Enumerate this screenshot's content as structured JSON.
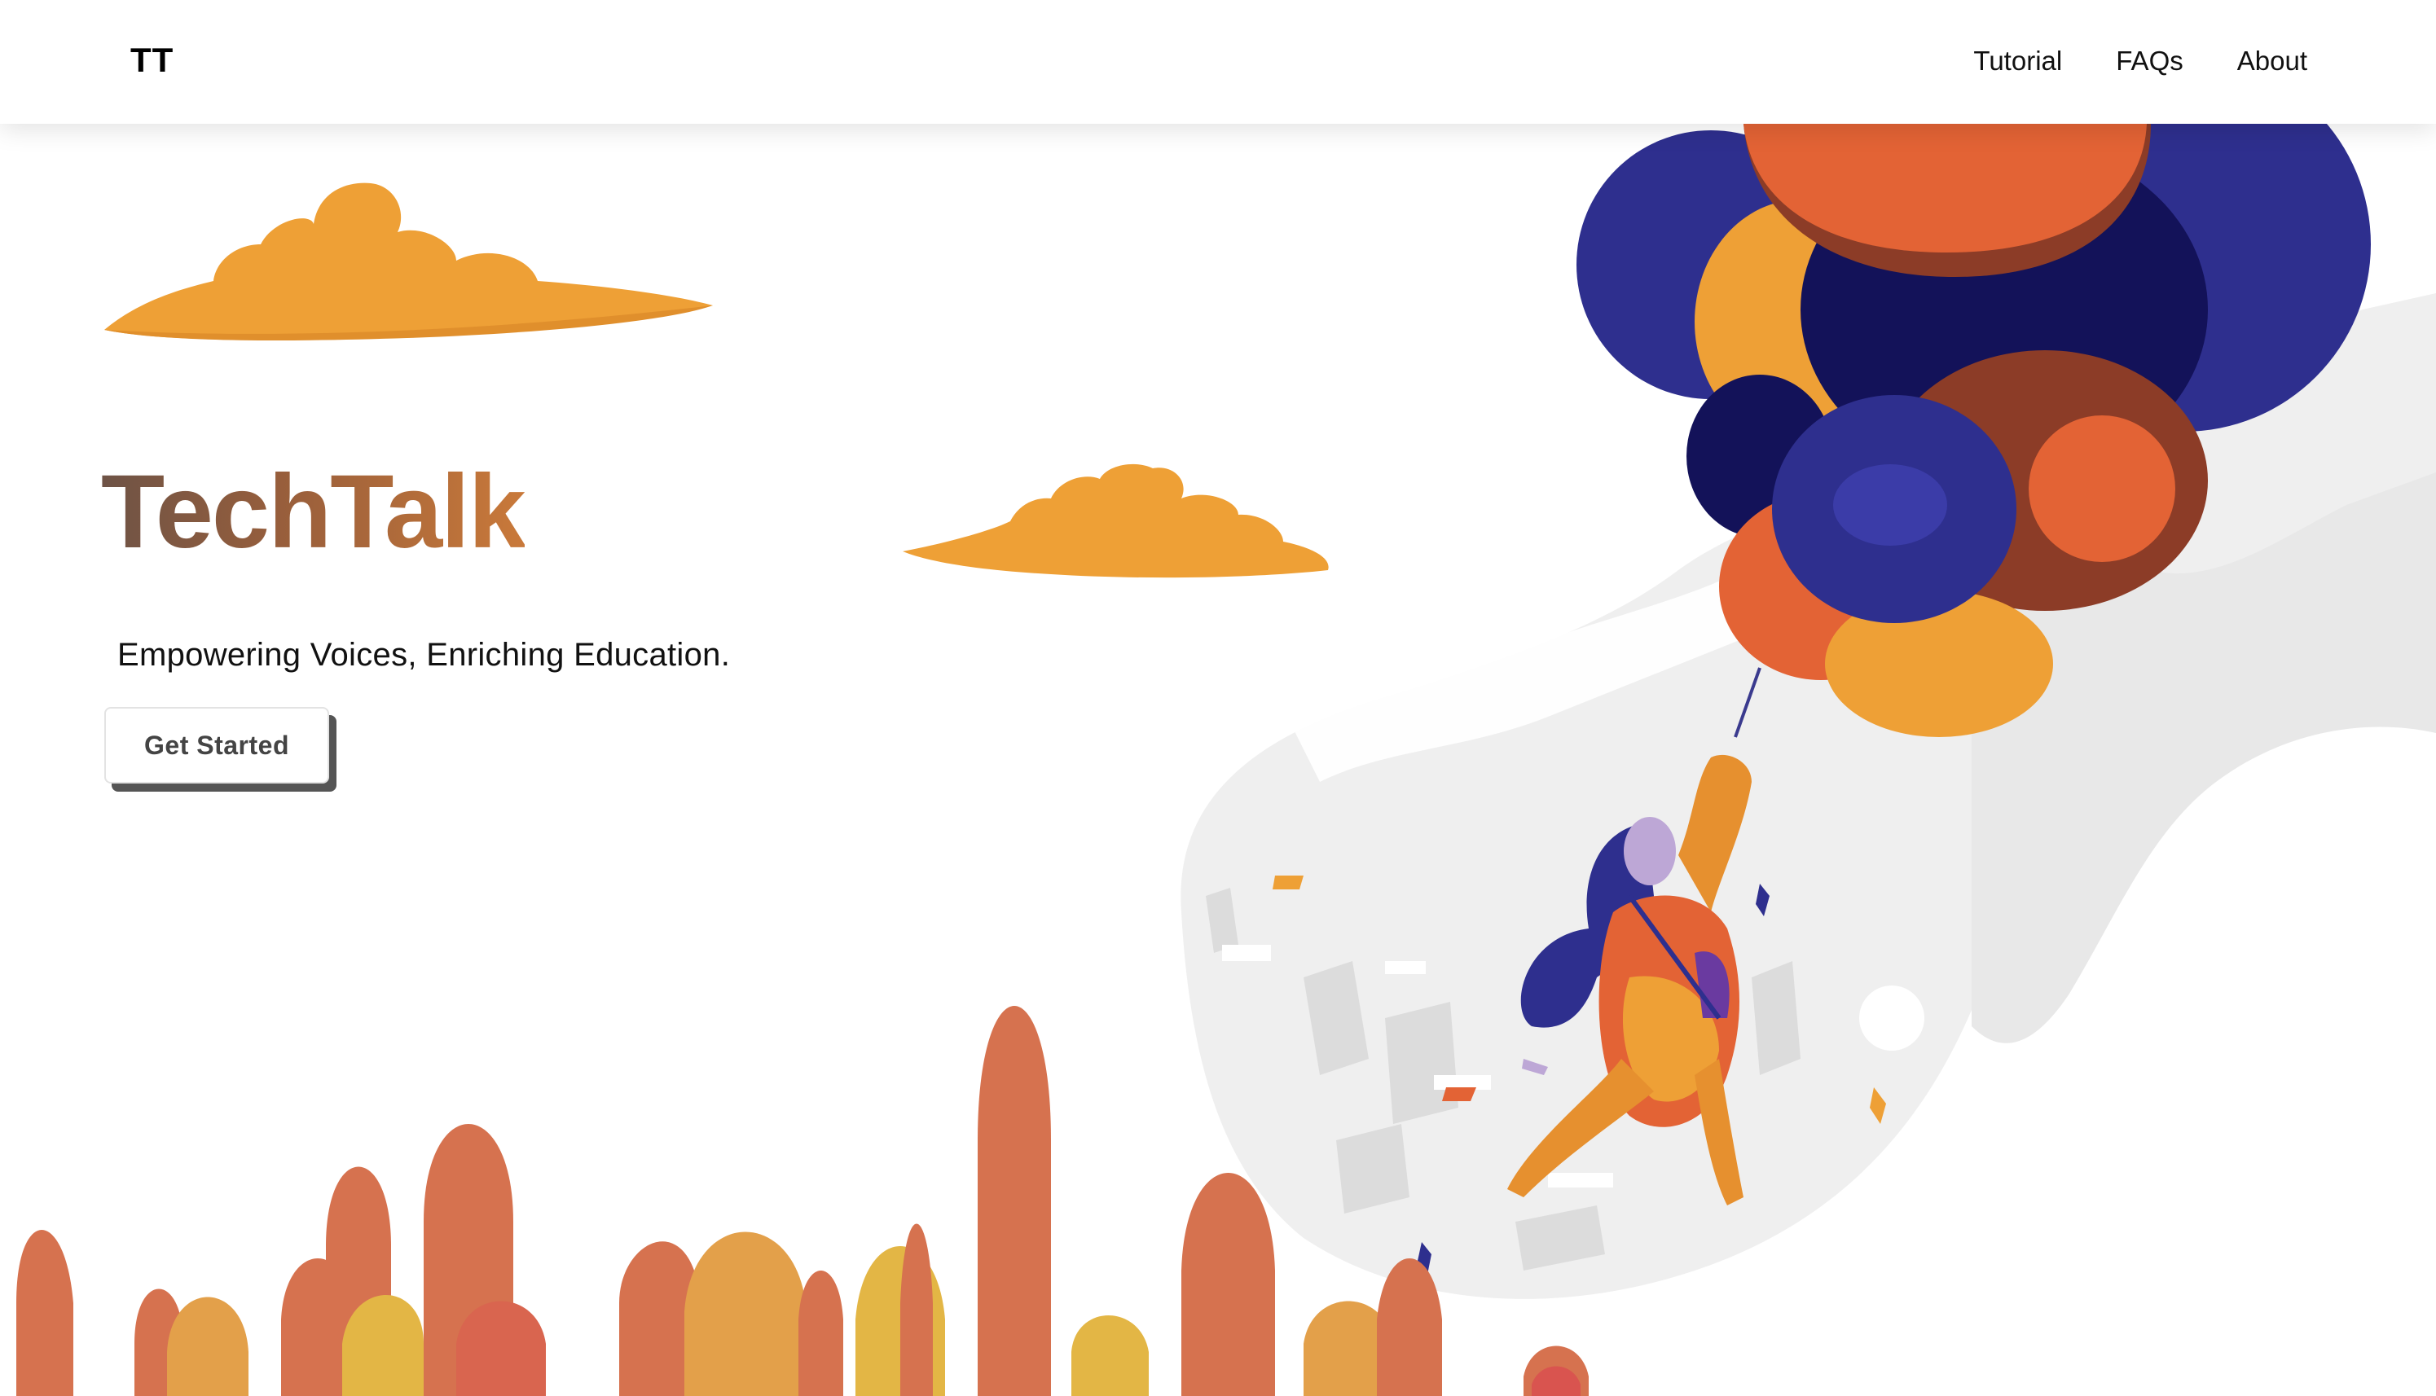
{
  "navbar": {
    "logo": "TT",
    "links": [
      "Tutorial",
      "FAQs",
      "About"
    ]
  },
  "hero": {
    "title": "TechTalk",
    "tagline": "Empowering Voices, Enriching Education.",
    "cta_label": "Get Started"
  },
  "colors": {
    "cloud": "#eea036",
    "balloon_navy": "#2e2f8e",
    "balloon_orange": "#e36335",
    "trees_coral": "#d6724f",
    "trees_yellow": "#e3b645"
  },
  "illustration": {
    "subject": "woman floating with balloons"
  }
}
